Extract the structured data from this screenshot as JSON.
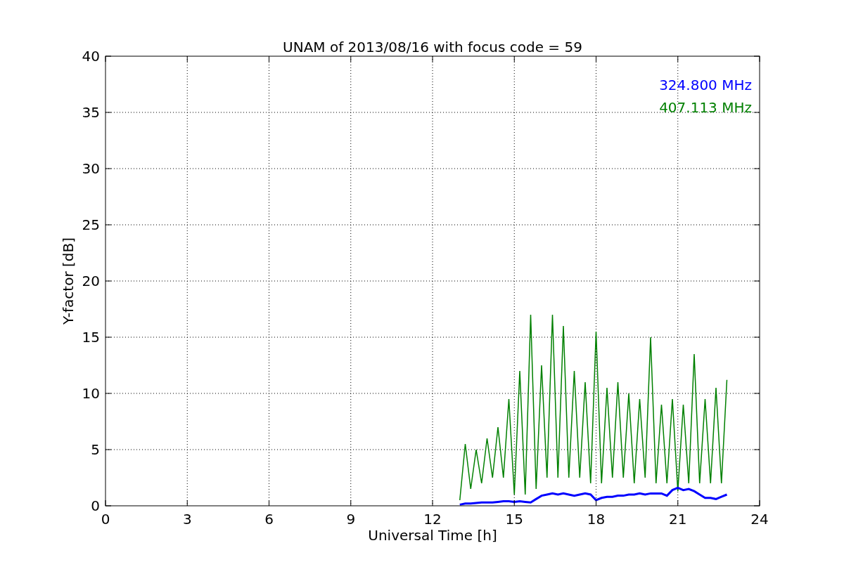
{
  "chart_data": {
    "type": "line",
    "title": "UNAM of 2013/08/16 with focus code = 59",
    "xlabel": "Universal Time [h]",
    "ylabel": "Y-factor [dB]",
    "x": [
      13.0,
      13.2,
      13.4,
      13.6,
      13.8,
      14.0,
      14.2,
      14.4,
      14.6,
      14.8,
      15.0,
      15.2,
      15.4,
      15.6,
      15.8,
      16.0,
      16.2,
      16.4,
      16.6,
      16.8,
      17.0,
      17.2,
      17.4,
      17.6,
      17.8,
      18.0,
      18.2,
      18.4,
      18.6,
      18.8,
      19.0,
      19.2,
      19.4,
      19.6,
      19.8,
      20.0,
      20.2,
      20.4,
      20.6,
      20.8,
      21.0,
      21.2,
      21.4,
      21.6,
      21.8,
      22.0,
      22.2,
      22.4,
      22.6,
      22.8
    ],
    "series": [
      {
        "name": "324.800 MHz",
        "color": "#0000ff",
        "values": [
          0.1,
          0.2,
          0.2,
          0.25,
          0.3,
          0.3,
          0.3,
          0.35,
          0.4,
          0.4,
          0.35,
          0.4,
          0.35,
          0.3,
          0.6,
          0.9,
          1.0,
          1.1,
          1.0,
          1.1,
          1.0,
          0.9,
          1.0,
          1.1,
          1.0,
          0.5,
          0.7,
          0.8,
          0.8,
          0.9,
          0.9,
          1.0,
          1.0,
          1.1,
          1.0,
          1.1,
          1.1,
          1.1,
          0.9,
          1.4,
          1.6,
          1.4,
          1.5,
          1.3,
          1.0,
          0.7,
          0.7,
          0.6,
          0.8,
          1.0
        ]
      },
      {
        "name": "407.113 MHz",
        "color": "#008000",
        "values": [
          0.5,
          5.5,
          1.5,
          5,
          2,
          6,
          2.5,
          7,
          2.5,
          9.5,
          1,
          12,
          1,
          17,
          1.5,
          12.5,
          2.5,
          17,
          2.5,
          16,
          2.5,
          12,
          2.5,
          11,
          2,
          15.5,
          2,
          10.5,
          2.5,
          11,
          2.5,
          10,
          2,
          9.5,
          2.5,
          15,
          2,
          9,
          2,
          9.5,
          1.3,
          9,
          2,
          13.5,
          2,
          9.5,
          2,
          10.5,
          2,
          11.2
        ]
      }
    ],
    "xlim": [
      0,
      24
    ],
    "ylim": [
      0,
      40
    ],
    "xticks": [
      0,
      3,
      6,
      9,
      12,
      15,
      18,
      21,
      24
    ],
    "yticks": [
      0,
      5,
      10,
      15,
      20,
      25,
      30,
      35,
      40
    ],
    "grid": true
  }
}
